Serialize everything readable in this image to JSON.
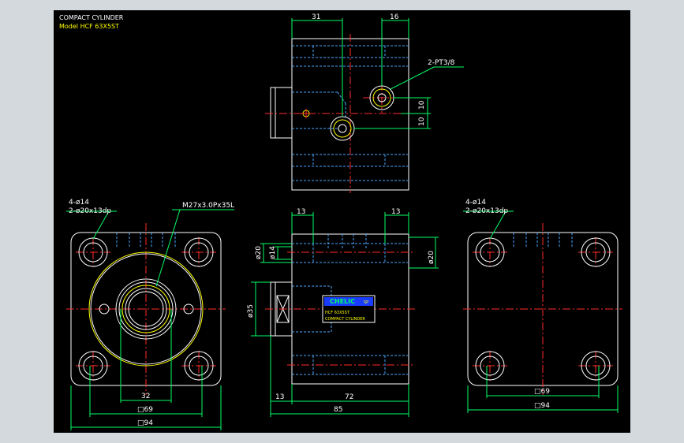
{
  "title_block": {
    "line1": "COMPACT CYLINDER",
    "line2": "Model  HCF 63X5ST"
  },
  "callouts": {
    "port": "2-PT3/8",
    "holes_left": "4-ø14",
    "cbore_left": "2-ø20x13dp",
    "thread": "M27x3.0Px35L",
    "holes_right": "4-ø14",
    "cbore_right": "2-ø20x13dp"
  },
  "dimensions": {
    "top_width_31": "31",
    "top_width_16": "16",
    "top_right_10a": "10",
    "top_right_10b": "10",
    "side_13_left": "13",
    "side_13_right": "13",
    "side_dia20_left": "ø20",
    "side_dia14": "ø14",
    "side_dia20_right": "ø20",
    "side_dia35": "ø35",
    "side_bottom_13": "13",
    "side_bottom_72": "72",
    "side_bottom_85": "85",
    "front_32": "32",
    "front_sq69": "□69",
    "front_sq94": "□94",
    "right_sq69": "□69",
    "right_sq94": "□94"
  },
  "nameplate": {
    "brand": "CHELIC",
    "badge": "SP",
    "model": "HCF 63X5ST",
    "desc": "COMPACT CYLINDER"
  },
  "colors": {
    "background": "#000000",
    "outline": "#ffffff",
    "hidden": "#4aa8ff",
    "center": "#ff2a2a",
    "dimension": "#00ff66",
    "annotation_text": "#ffffff",
    "model_text": "#ffff00",
    "bore_ring": "#ffff00"
  }
}
